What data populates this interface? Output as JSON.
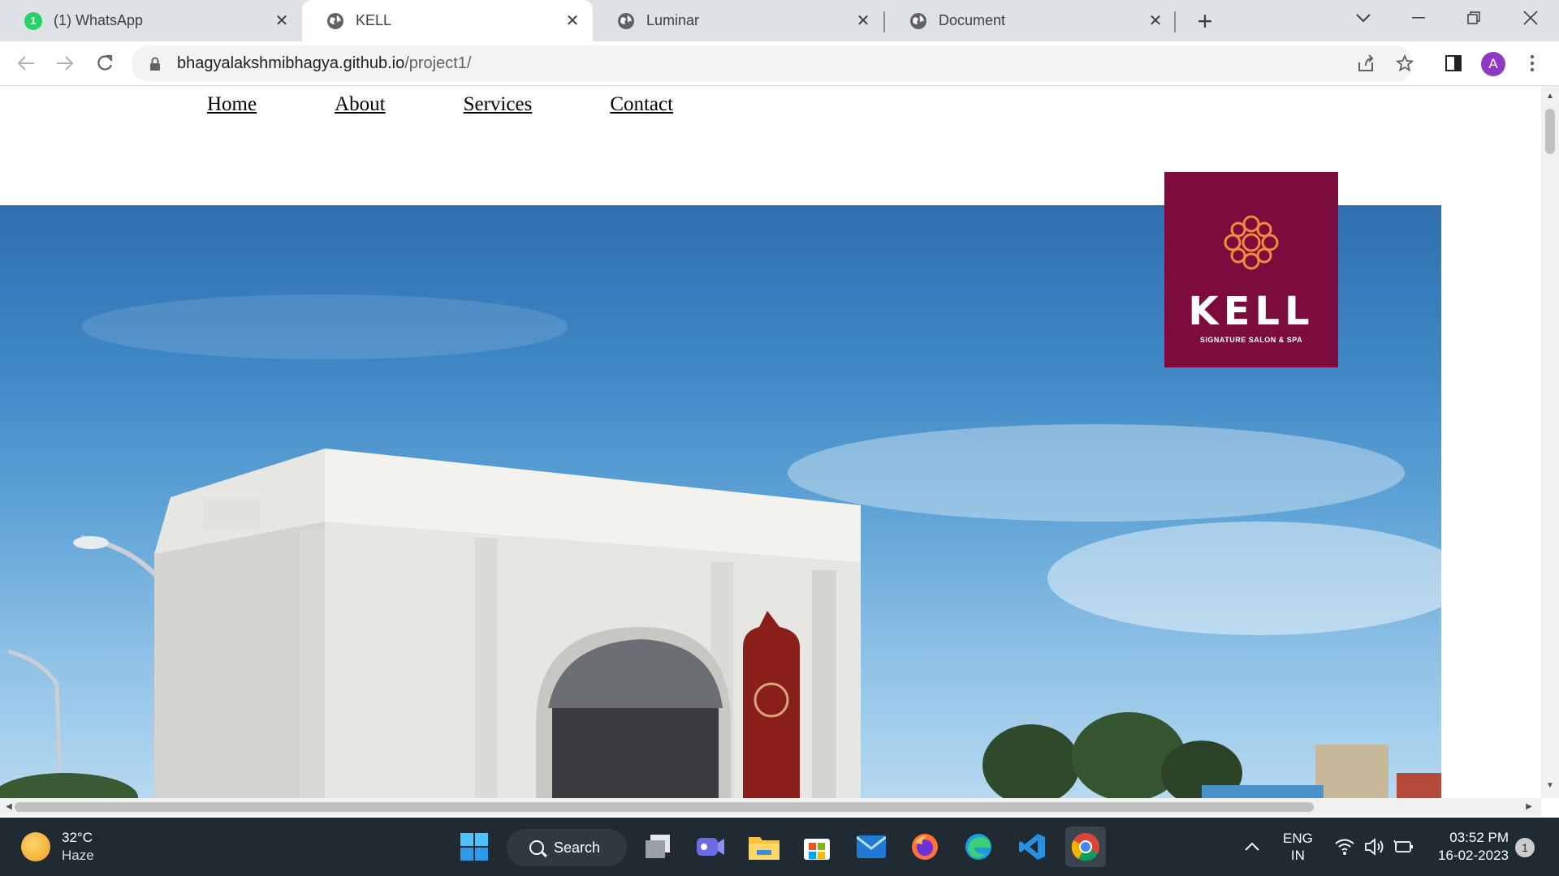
{
  "browser": {
    "tabs": [
      {
        "title": "(1) WhatsApp",
        "badge": "1",
        "icon": "whatsapp-icon"
      },
      {
        "title": "KELL",
        "icon": "globe-icon"
      },
      {
        "title": "Luminar",
        "icon": "globe-icon"
      },
      {
        "title": "Document",
        "icon": "globe-icon"
      }
    ],
    "active_tab": 1,
    "url_host": "bhagyalakshmibhagya.github.io",
    "url_path": "/project1/",
    "profile_initial": "A"
  },
  "site": {
    "nav": [
      "Home",
      "About",
      "Services",
      "Contact"
    ],
    "logo": {
      "brand": "KELL",
      "tagline": "SIGNATURE SALON & SPA",
      "bg_color": "#7c0c3d"
    }
  },
  "taskbar": {
    "weather": {
      "temp": "32°C",
      "condition": "Haze"
    },
    "search_label": "Search",
    "language": {
      "line1": "ENG",
      "line2": "IN"
    },
    "time": "03:52 PM",
    "date": "16-02-2023",
    "notification_count": "1"
  }
}
